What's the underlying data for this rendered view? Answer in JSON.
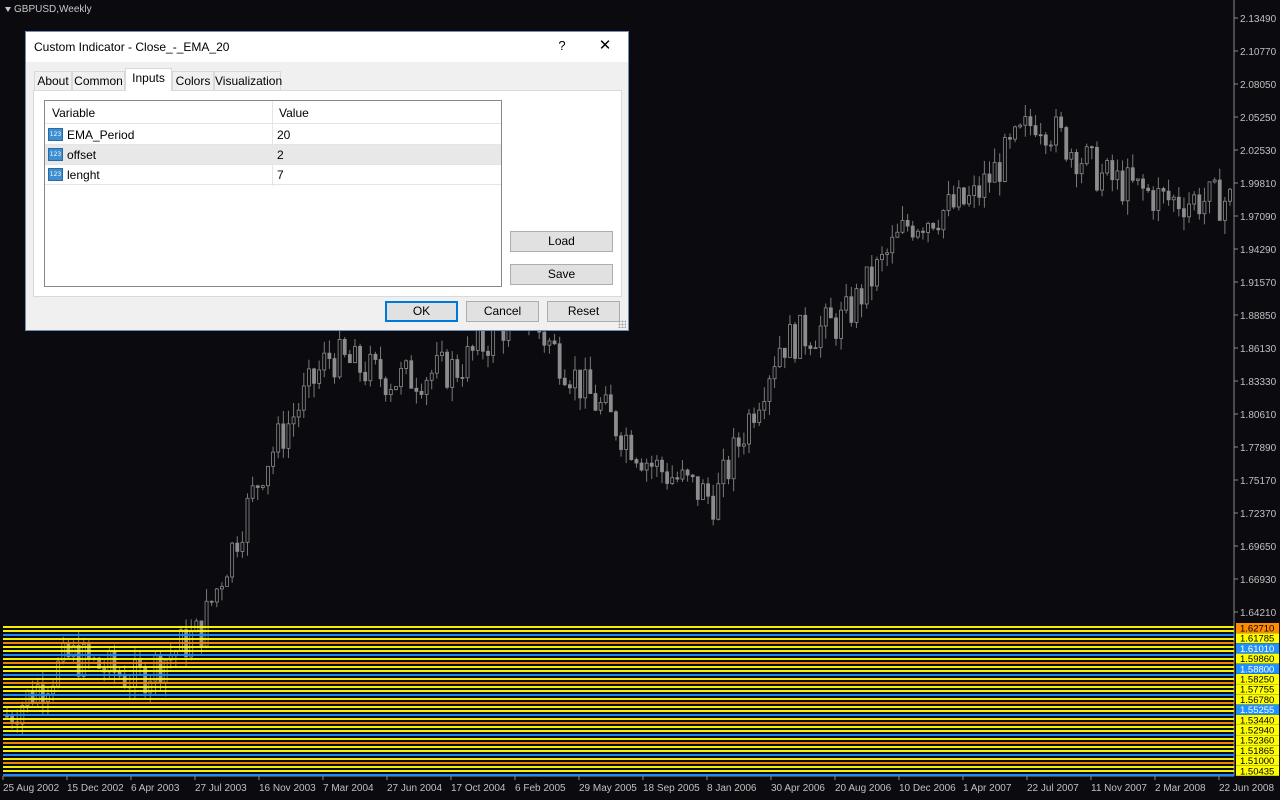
{
  "chart": {
    "title": "GBPUSD,Weekly",
    "price_scale": [
      "2.13490",
      "2.10770",
      "2.08050",
      "2.05250",
      "2.02530",
      "1.99810",
      "1.97090",
      "1.94290",
      "1.91570",
      "1.88850",
      "1.86130",
      "1.83330",
      "1.80610",
      "1.77890",
      "1.75170",
      "1.72370",
      "1.69650",
      "1.66930",
      "1.64210"
    ],
    "highlighted_prices": [
      {
        "text": "1.62710",
        "bg": "#ff8c00",
        "color": "#000000"
      },
      {
        "text": "1.61785",
        "bg": "#ffff00",
        "color": "#000000"
      },
      {
        "text": "1.61010",
        "bg": "#1e90ff",
        "color": "#ffffff"
      },
      {
        "text": "1.59860",
        "bg": "#ffff00",
        "color": "#000000"
      },
      {
        "text": "1.58800",
        "bg": "#1e90ff",
        "color": "#ffffff"
      },
      {
        "text": "1.58250",
        "bg": "#ffff00",
        "color": "#000000"
      },
      {
        "text": "1.57755",
        "bg": "#ffff00",
        "color": "#000000"
      },
      {
        "text": "1.56780",
        "bg": "#ffff00",
        "color": "#000000"
      },
      {
        "text": "1.55255",
        "bg": "#1e90ff",
        "color": "#ffffff"
      },
      {
        "text": "1.53440",
        "bg": "#ffff00",
        "color": "#000000"
      },
      {
        "text": "1.52940",
        "bg": "#ffff00",
        "color": "#000000"
      },
      {
        "text": "1.52360",
        "bg": "#ffff00",
        "color": "#000000"
      },
      {
        "text": "1.51865",
        "bg": "#ffff00",
        "color": "#000000"
      },
      {
        "text": "1.51000",
        "bg": "#ffff00",
        "color": "#000000"
      },
      {
        "text": "1.50435",
        "bg": "#ffff00",
        "color": "#000000"
      }
    ],
    "time_scale": [
      "25 Aug 2002",
      "15 Dec 2002",
      "6 Apr 2003",
      "27 Jul 2003",
      "16 Nov 2003",
      "7 Mar 2004",
      "27 Jun 2004",
      "17 Oct 2004",
      "6 Feb 2005",
      "29 May 2005",
      "18 Sep 2005",
      "8 Jan 2006",
      "30 Apr 2006",
      "20 Aug 2006",
      "10 Dec 2006",
      "1 Apr 2007",
      "22 Jul 2007",
      "11 Nov 2007",
      "2 Mar 2008",
      "22 Jun 2008"
    ],
    "colors": {
      "background": "#0b0a0f",
      "candle": "#8c8c8c",
      "axis_text": "#c0c0c0",
      "band_yellow": "#ffff00",
      "band_blue": "#1e90ff",
      "band_orange": "#ff8c00"
    }
  },
  "chart_data": {
    "type": "candlestick",
    "x": [
      "25 Aug 2002",
      "15 Dec 2002",
      "6 Apr 2003",
      "27 Jul 2003",
      "16 Nov 2003",
      "7 Mar 2004",
      "27 Jun 2004",
      "17 Oct 2004",
      "6 Feb 2005",
      "29 May 2005",
      "18 Sep 2005",
      "8 Jan 2006",
      "30 Apr 2006",
      "20 Aug 2006",
      "10 Dec 2006",
      "1 Apr 2007",
      "22 Jul 2007",
      "11 Nov 2007",
      "2 Mar 2008",
      "22 Jun 2008"
    ],
    "close": [
      1.55,
      1.6,
      1.58,
      1.62,
      1.76,
      1.85,
      1.83,
      1.84,
      1.89,
      1.82,
      1.76,
      1.73,
      1.86,
      1.88,
      1.96,
      1.98,
      2.05,
      2.0,
      1.98,
      1.98
    ],
    "ylim": [
      1.5,
      2.14
    ]
  },
  "dialog": {
    "title": "Custom Indicator - Close_-_EMA_20",
    "help": "?",
    "close": "✕",
    "tabs": [
      "About",
      "Common",
      "Inputs",
      "Colors",
      "Visualization"
    ],
    "active_tab": "Inputs",
    "grid": {
      "headers": {
        "variable": "Variable",
        "value": "Value"
      },
      "icon_text": "123",
      "rows": [
        {
          "variable": "EMA_Period",
          "value": "20"
        },
        {
          "variable": "offset",
          "value": "2"
        },
        {
          "variable": "lenght",
          "value": "7"
        }
      ]
    },
    "buttons": {
      "load": "Load",
      "save": "Save",
      "ok": "OK",
      "cancel": "Cancel",
      "reset": "Reset"
    }
  }
}
